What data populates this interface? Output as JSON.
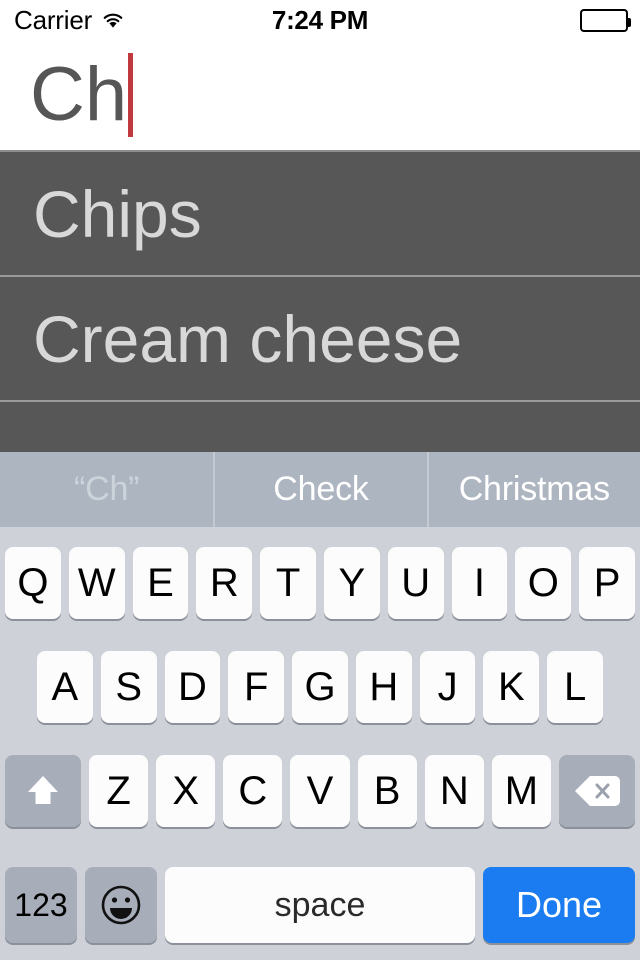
{
  "status_bar": {
    "carrier": "Carrier",
    "wifi_icon": "wifi-icon",
    "time": "7:24 PM",
    "battery_icon": "battery-full-icon"
  },
  "text_field": {
    "value": "Ch",
    "caret_color": "#c0393f",
    "text_color": "#565656"
  },
  "suggestions": {
    "background": "#575757",
    "items": [
      {
        "label": "Chips"
      },
      {
        "label": "Cream cheese"
      }
    ]
  },
  "autocorrect_bar": {
    "background": "#adb5c1",
    "items": [
      {
        "label": "“Ch”",
        "dim": true
      },
      {
        "label": "Check",
        "dim": false
      },
      {
        "label": "Christmas",
        "dim": false
      }
    ]
  },
  "keyboard": {
    "background": "#ced2d8",
    "key_background": "#fcfcfd",
    "special_key_background": "#a7aeb9",
    "row1": [
      "Q",
      "W",
      "E",
      "R",
      "T",
      "Y",
      "U",
      "I",
      "O",
      "P"
    ],
    "row2": [
      "A",
      "S",
      "D",
      "F",
      "G",
      "H",
      "J",
      "K",
      "L"
    ],
    "row3": [
      "Z",
      "X",
      "C",
      "V",
      "B",
      "N",
      "M"
    ],
    "shift_key": "shift-icon",
    "delete_key": "delete-icon",
    "numbers_key": "123",
    "emoji_key": "emoji-icon",
    "space_key": "space",
    "return_key": "Done",
    "return_key_color": "#1a7cf0"
  }
}
